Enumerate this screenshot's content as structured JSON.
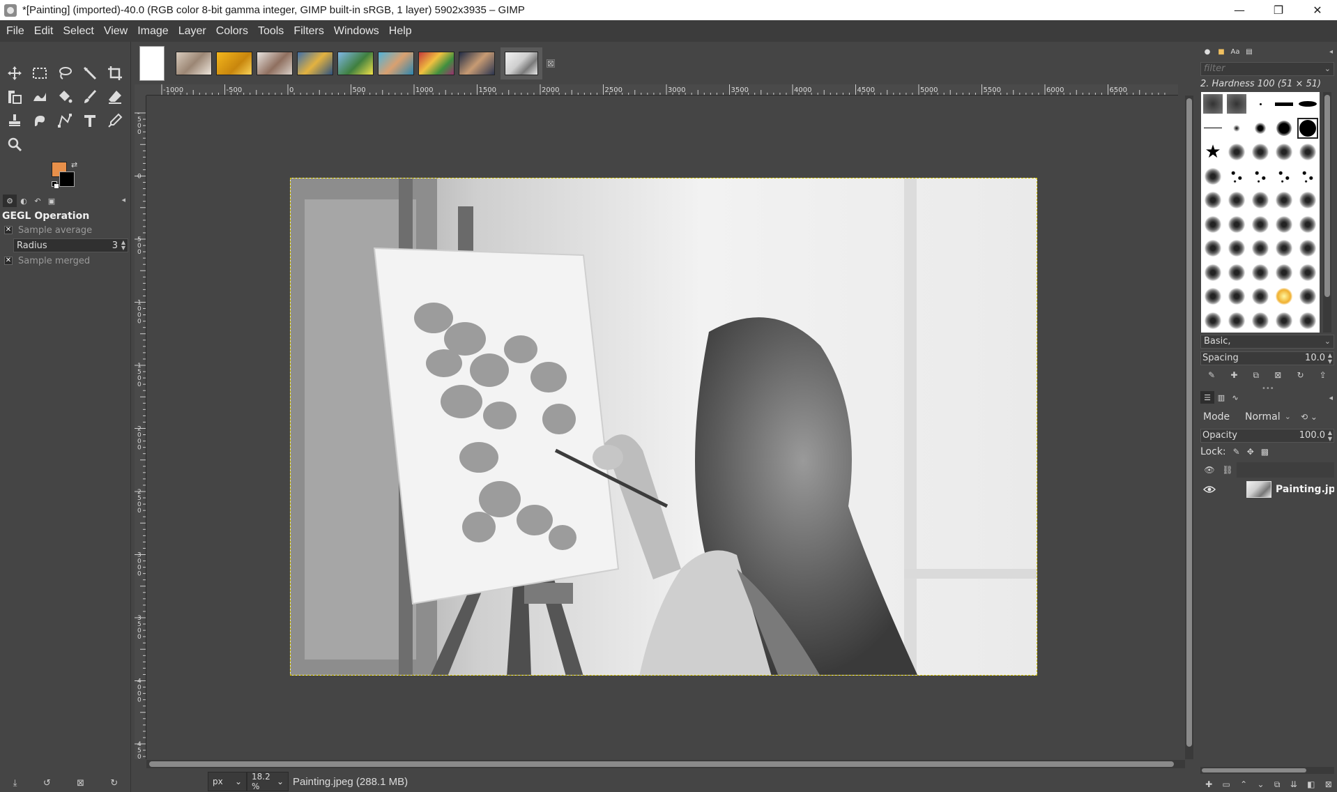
{
  "window": {
    "title": "*[Painting] (imported)-40.0 (RGB color 8-bit gamma integer, GIMP built-in sRGB, 1 layer) 5902x3935 – GIMP",
    "controls": [
      "—",
      "❐",
      "✕"
    ]
  },
  "menu": [
    "File",
    "Edit",
    "Select",
    "View",
    "Image",
    "Layer",
    "Colors",
    "Tools",
    "Filters",
    "Windows",
    "Help"
  ],
  "colors": {
    "foreground": "#e8904a",
    "background": "#000000",
    "selection_outline": "#d8c800",
    "ui_background": "#454545"
  },
  "tool_options": {
    "heading": "GEGL Operation",
    "sample_average_label": "Sample average",
    "radius_label": "Radius",
    "radius_value": "3",
    "sample_merged_label": "Sample merged",
    "check_mark": "✕"
  },
  "image_tabs": {
    "close_icon": "⊠"
  },
  "rulers": {
    "h_ticks": [
      "-1000",
      "-500",
      "0",
      "500",
      "1000",
      "1500",
      "2000",
      "2500",
      "3000",
      "3500",
      "4000",
      "4500",
      "5000",
      "5500",
      "6000",
      "6500"
    ],
    "v_ticks": [
      "-500",
      "0",
      "500",
      "1000",
      "1500",
      "2000",
      "2500",
      "3000",
      "3500",
      "4000",
      "4500"
    ]
  },
  "status": {
    "unit": "px",
    "zoom": "18.2 %",
    "message": "Painting.jpeg (288.1 MB)"
  },
  "brushes": {
    "filter_placeholder": "filter",
    "selected_name": "2. Hardness 100 (51 × 51)",
    "tag": "Basic,",
    "spacing_label": "Spacing",
    "spacing_value": "10.0"
  },
  "layers": {
    "mode_label": "Mode",
    "mode_value": "Normal",
    "opacity_label": "Opacity",
    "opacity_value": "100.0",
    "lock_label": "Lock:",
    "layer_name": "Painting.jpeg"
  }
}
